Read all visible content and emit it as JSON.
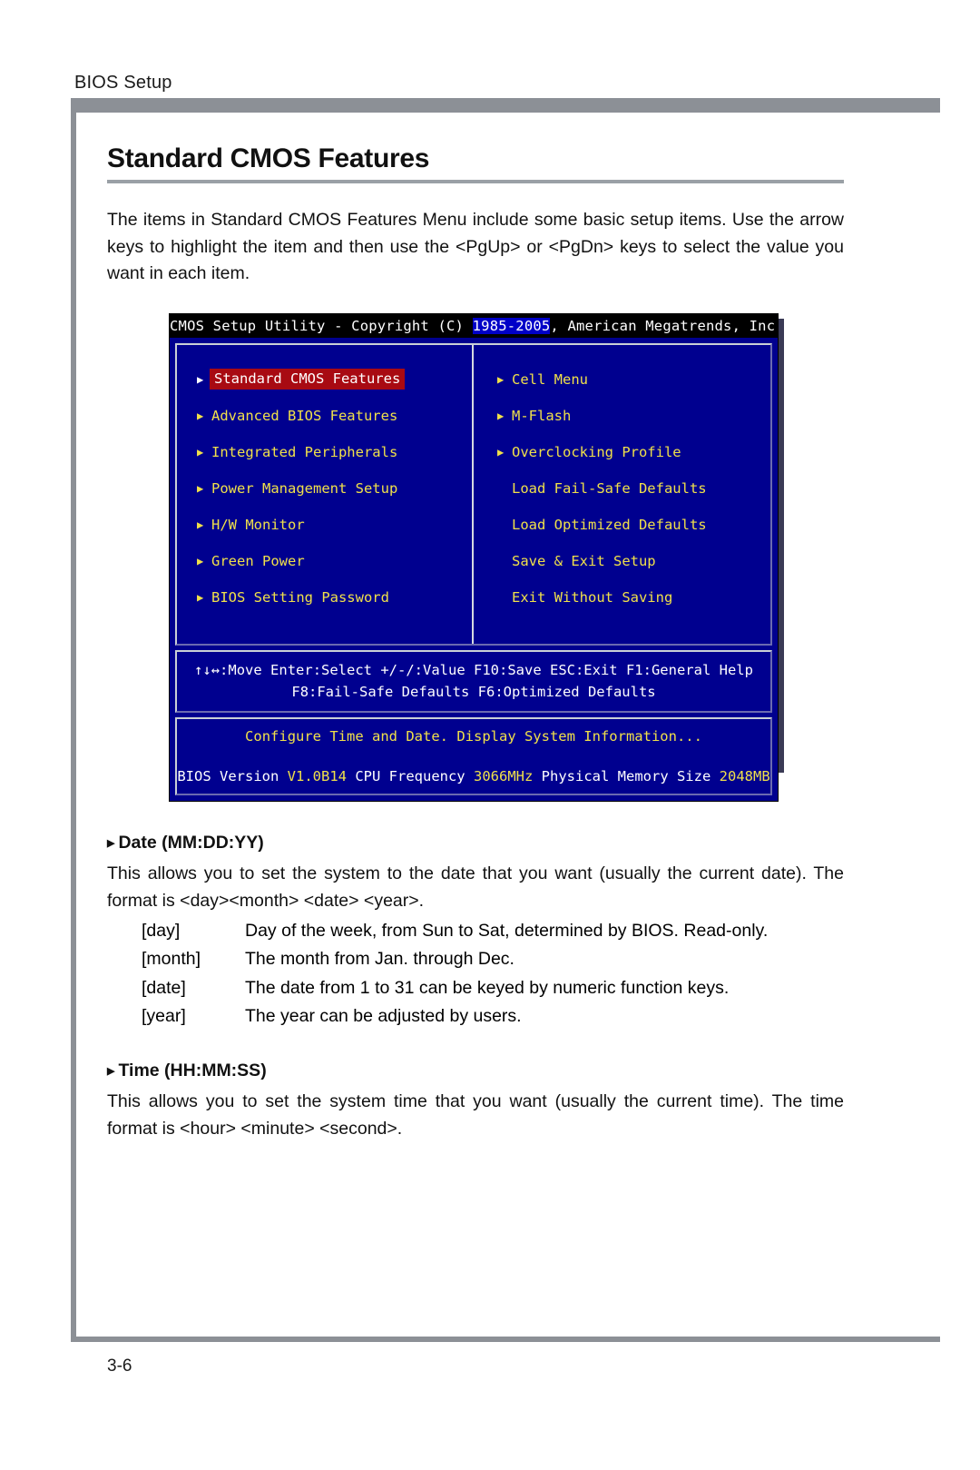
{
  "running_head": "BIOS Setup",
  "page_title": "Standard CMOS Features",
  "intro_paragraph": "The items in Standard CMOS Features Menu include some basic setup items. Use the arrow keys to highlight the item and then use the <PgUp> or <PgDn> keys to select the value you want in each item.",
  "bios": {
    "titlebar": {
      "prefix": "CMOS Setup Utility - Copyright (C) ",
      "highlight": "1985-2005",
      "suffix": ", American Megatrends, Inc."
    },
    "left_column": [
      {
        "label": "Standard CMOS Features",
        "arrow": true,
        "selected": true
      },
      {
        "label": "Advanced BIOS Features",
        "arrow": true,
        "selected": false
      },
      {
        "label": "Integrated Peripherals",
        "arrow": true,
        "selected": false
      },
      {
        "label": "Power Management Setup",
        "arrow": true,
        "selected": false
      },
      {
        "label": "H/W Monitor",
        "arrow": true,
        "selected": false
      },
      {
        "label": "Green Power",
        "arrow": true,
        "selected": false
      },
      {
        "label": "BIOS Setting Password",
        "arrow": true,
        "selected": false
      }
    ],
    "right_column": [
      {
        "label": "Cell Menu",
        "arrow": true,
        "selected": false
      },
      {
        "label": "M-Flash",
        "arrow": true,
        "selected": false
      },
      {
        "label": "Overclocking Profile",
        "arrow": true,
        "selected": false
      },
      {
        "label": "Load Fail-Safe Defaults",
        "arrow": false,
        "selected": false
      },
      {
        "label": "Load Optimized Defaults",
        "arrow": false,
        "selected": false
      },
      {
        "label": "Save & Exit Setup",
        "arrow": false,
        "selected": false
      },
      {
        "label": "Exit Without Saving",
        "arrow": false,
        "selected": false
      }
    ],
    "help_line_1": "↑↓↔:Move  Enter:Select  +/-/:Value  F10:Save  ESC:Exit  F1:General Help",
    "help_line_2": "F8:Fail-Safe Defaults   F6:Optimized Defaults",
    "status_line": "Configure Time and Date.  Display System Information...",
    "version_line": {
      "bios_version_label": "BIOS Version",
      "bios_version_value": "V1.0B14",
      "cpu_freq_label": "CPU Frequency",
      "cpu_freq_value": "3066MHz",
      "memory_label": "Physical Memory Size",
      "memory_value": "2048MB"
    },
    "colors": {
      "background": "#00008f",
      "menu_text": "#f0e04a",
      "selected_background": "#a80a12",
      "titlebar_background": "#000000",
      "titlebar_highlight": "#0000c8"
    }
  },
  "sections": [
    {
      "heading": "Date (MM:DD:YY)",
      "bullet_icon": "triangle-right-icon",
      "paragraph": "This allows you to set the system to the date that you want (usually the current date). The format is <day><month> <date> <year>.",
      "definitions": [
        {
          "term": "[day]",
          "desc": "Day of the week, from Sun to Sat, determined by BIOS. Read-only."
        },
        {
          "term": "[month]",
          "desc": "The month from Jan. through Dec."
        },
        {
          "term": "[date]",
          "desc": "The date from 1 to 31 can be keyed by numeric function keys."
        },
        {
          "term": "[year]",
          "desc": "The year can be adjusted by users."
        }
      ]
    },
    {
      "heading": "Time (HH:MM:SS)",
      "bullet_icon": "triangle-right-icon",
      "paragraph": "This allows you to set the system time that you want (usually the current time). The time format is <hour> <minute> <second>.",
      "definitions": []
    }
  ],
  "folio": "3-6"
}
